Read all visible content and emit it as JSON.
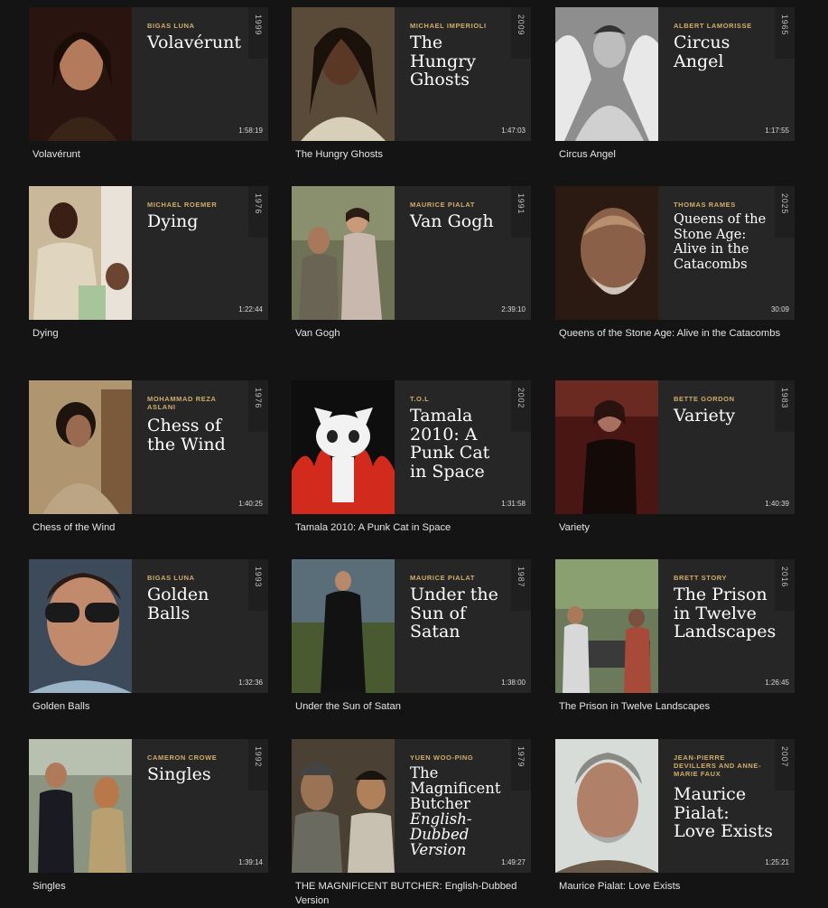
{
  "films": [
    {
      "director": "Bigas Luna",
      "title": "Volavérunt",
      "title_lines": [
        "Volavérunt"
      ],
      "year": "1999",
      "duration": "1:58:19",
      "caption": "Volavérunt"
    },
    {
      "director": "Michael Imperioli",
      "title": "The Hungry Ghosts",
      "title_lines": [
        "The",
        "Hungry",
        "Ghosts"
      ],
      "year": "2009",
      "duration": "1:47:03",
      "caption": "The Hungry Ghosts"
    },
    {
      "director": "Albert Lamorisse",
      "title": "Circus Angel",
      "title_lines": [
        "Circus",
        "Angel"
      ],
      "year": "1965",
      "duration": "1:17:55",
      "caption": "Circus Angel"
    },
    {
      "director": "Michael Roemer",
      "title": "Dying",
      "title_lines": [
        "Dying"
      ],
      "year": "1976",
      "duration": "1:22:44",
      "caption": "Dying"
    },
    {
      "director": "Maurice Pialat",
      "title": "Van Gogh",
      "title_lines": [
        "Van Gogh"
      ],
      "year": "1991",
      "duration": "2:39:10",
      "caption": "Van Gogh"
    },
    {
      "director": "Thomas Rames",
      "title": "Queens of the Stone Age: Alive in the Catacombs",
      "title_lines": [
        "Queens of the",
        "Stone Age:",
        "Alive in the",
        "Catacombs"
      ],
      "year": "2025",
      "duration": "30:09",
      "caption": "Queens of the Stone Age: Alive in the Catacombs"
    },
    {
      "director": "Mohammad Reza Aslani",
      "title": "Chess of the Wind",
      "title_lines": [
        "Chess of",
        "the Wind"
      ],
      "year": "1976",
      "duration": "1:40:25",
      "caption": "Chess of the Wind"
    },
    {
      "director": "T.O.L",
      "title": "Tamala 2010: A Punk Cat in Space",
      "title_lines": [
        "Tamala",
        "2010: A",
        "Punk Cat",
        "in Space"
      ],
      "year": "2002",
      "duration": "1:31:58",
      "caption": "Tamala 2010: A Punk Cat in Space"
    },
    {
      "director": "Bette Gordon",
      "title": "Variety",
      "title_lines": [
        "Variety"
      ],
      "year": "1983",
      "duration": "1:40:39",
      "caption": "Variety"
    },
    {
      "director": "Bigas Luna",
      "title": "Golden Balls",
      "title_lines": [
        "Golden",
        "Balls"
      ],
      "year": "1993",
      "duration": "1:32:36",
      "caption": "Golden Balls"
    },
    {
      "director": "Maurice Pialat",
      "title": "Under the Sun of Satan",
      "title_lines": [
        "Under the",
        "Sun of",
        "Satan"
      ],
      "year": "1987",
      "duration": "1:38:00",
      "caption": "Under the Sun of Satan"
    },
    {
      "director": "Brett Story",
      "title": "The Prison in Twelve Landscapes",
      "title_lines": [
        "The Prison",
        "in Twelve",
        "Landscapes"
      ],
      "year": "2016",
      "duration": "1:26:45",
      "caption": "The Prison in Twelve Landscapes"
    },
    {
      "director": "Cameron Crowe",
      "title": "Singles",
      "title_lines": [
        "Singles"
      ],
      "year": "1992",
      "duration": "1:39:14",
      "caption": "Singles"
    },
    {
      "director": "Yuen Woo-Ping",
      "title": "The Magnificent Butcher English-Dubbed Version",
      "title_lines": [
        "The",
        "Magnificent",
        "Butcher"
      ],
      "title_italic_lines": [
        "English-Dubbed",
        "Version"
      ],
      "year": "1979",
      "duration": "1:49:27",
      "caption": "THE MAGNIFICENT BUTCHER: English-Dubbed Version"
    },
    {
      "director": "Jean-Pierre Devillers and Anne-Marie Faux",
      "title": "Maurice Pialat: Love Exists",
      "title_lines": [
        "Maurice",
        "Pialat:",
        "Love Exists"
      ],
      "year": "2007",
      "duration": "1:25:21",
      "caption": "Maurice Pialat: Love Exists"
    }
  ]
}
